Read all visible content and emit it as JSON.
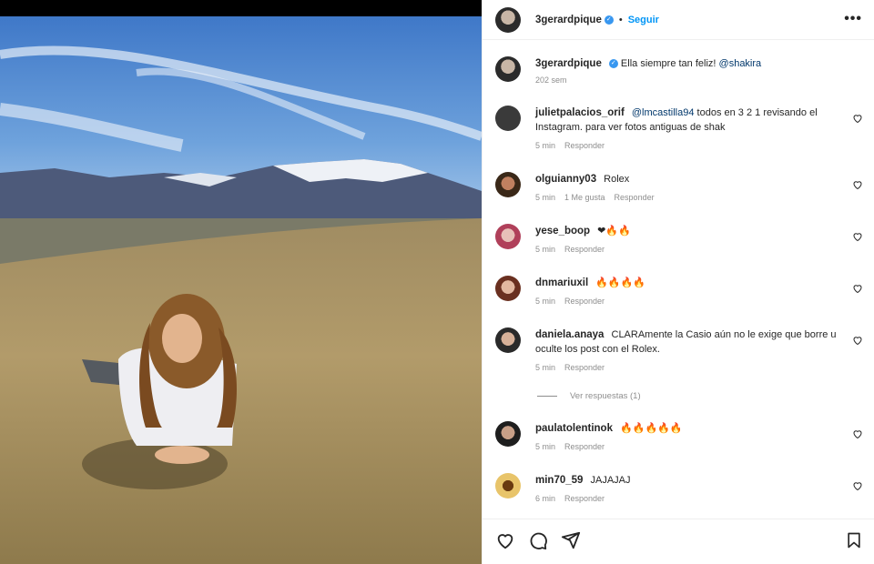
{
  "post": {
    "username": "3gerardpique",
    "follow_label": "Seguir",
    "separator": "•",
    "more_label": "•••",
    "verified_glyph": "✓",
    "caption": "Ella siempre tan feliz!",
    "caption_mention": "@shakira",
    "caption_time": "202 sem"
  },
  "comments": [
    {
      "user": "julietpalacios_orif",
      "mention": "@lmcastilla94",
      "text": " todos en 3 2 1 revisando el Instagram. para ver fotos antiguas de shak",
      "time": "5 min",
      "likes": "",
      "reply": "Responder"
    },
    {
      "user": "olguianny03",
      "mention": "",
      "text": "Rolex",
      "time": "5 min",
      "likes": "1 Me gusta",
      "reply": "Responder"
    },
    {
      "user": "yese_boop",
      "mention": "",
      "text": "",
      "emoji": "❤🔥🔥",
      "time": "5 min",
      "likes": "",
      "reply": "Responder"
    },
    {
      "user": "dnmariuxil",
      "mention": "",
      "text": "",
      "emoji": "🔥🔥🔥🔥",
      "time": "5 min",
      "likes": "",
      "reply": "Responder"
    },
    {
      "user": "daniela.anaya",
      "mention": "",
      "text": "CLARAmente la Casio aún no le exige que borre u oculte los post con el Rolex.",
      "time": "5 min",
      "likes": "",
      "reply": "Responder"
    },
    {
      "user": "paulatolentinok",
      "mention": "",
      "text": "",
      "emoji": "🔥🔥🔥🔥🔥",
      "time": "5 min",
      "likes": "",
      "reply": "Responder"
    },
    {
      "user": "min70_59",
      "mention": "",
      "text": "JAJAJAJ",
      "time": "6 min",
      "likes": "",
      "reply": "Responder"
    }
  ],
  "view_replies": "Ver respuestas (1)",
  "icons": {
    "like": "heart-icon",
    "comment": "comment-icon",
    "share": "share-icon",
    "save": "bookmark-icon"
  },
  "colors": {
    "link_blue": "#0095f6",
    "mention_blue": "#00376b",
    "meta_gray": "#8e8e8e",
    "verified_blue": "#3897f0"
  }
}
